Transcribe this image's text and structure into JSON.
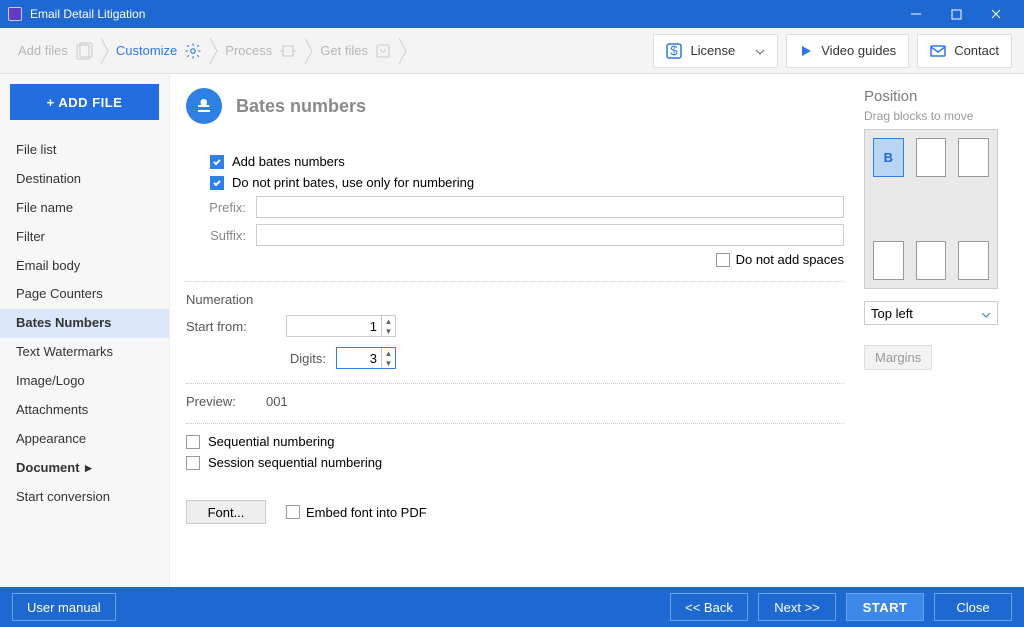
{
  "titlebar": {
    "title": "Email Detail Litigation"
  },
  "toolbar": {
    "crumbs": {
      "add_files": "Add files",
      "customize": "Customize",
      "process": "Process",
      "get_files": "Get files"
    },
    "license": "License",
    "video_guides": "Video guides",
    "contact": "Contact"
  },
  "sidebar": {
    "add_file": "+ ADD FILE",
    "items": [
      "File list",
      "Destination",
      "File name",
      "Filter",
      "Email body",
      "Page Counters",
      "Bates Numbers",
      "Text Watermarks",
      "Image/Logo",
      "Attachments",
      "Appearance",
      "Document",
      "Start conversion"
    ]
  },
  "page": {
    "title": "Bates numbers",
    "add_bates": "Add bates numbers",
    "no_print": "Do not print bates, use only for numbering",
    "prefix_label": "Prefix:",
    "suffix_label": "Suffix:",
    "prefix_value": "",
    "suffix_value": "",
    "no_spaces": "Do not add spaces",
    "numeration_label": "Numeration",
    "start_from_label": "Start from:",
    "start_from_value": "1",
    "digits_label": "Digits:",
    "digits_value": "3",
    "preview_label": "Preview:",
    "preview_value": "001",
    "sequential": "Sequential numbering",
    "session_seq": "Session sequential numbering",
    "font_btn": "Font...",
    "embed_font": "Embed font into PDF"
  },
  "position": {
    "title": "Position",
    "hint": "Drag blocks to move",
    "marker": "B",
    "select_value": "Top left",
    "margins": "Margins"
  },
  "footer": {
    "user_manual": "User manual",
    "back": "<< Back",
    "next": "Next >>",
    "start": "START",
    "close": "Close"
  }
}
